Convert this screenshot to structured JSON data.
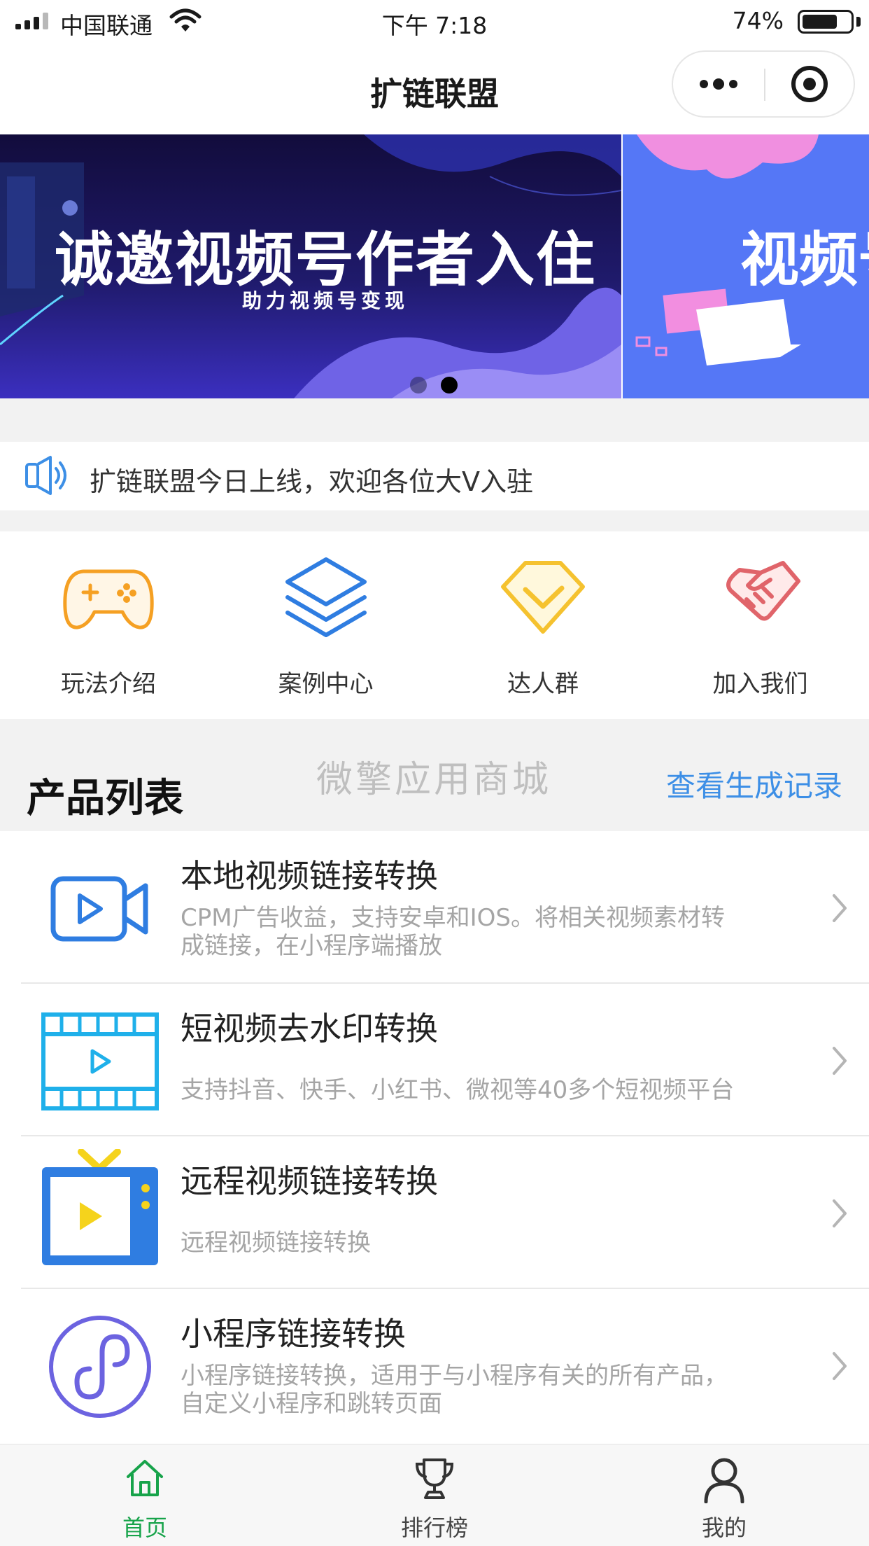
{
  "status_bar": {
    "carrier": "中国联通",
    "time": "下午 7:18",
    "battery_percent": "74%",
    "battery_level": 0.74,
    "icons": [
      "signal-icon",
      "wifi-icon",
      "battery-icon"
    ]
  },
  "nav": {
    "title": "扩链联盟",
    "icons": [
      "more-dots-icon",
      "close-capsule-icon"
    ]
  },
  "banner": {
    "slides": [
      {
        "title": "诚邀视频号作者入住",
        "subtitle": "助力视频号变现"
      },
      {
        "title": "视频号"
      }
    ],
    "active_index": 1
  },
  "notice": {
    "icon": "speaker-icon",
    "text": "扩链联盟今日上线，欢迎各位大V入驻"
  },
  "menu": [
    {
      "label": "玩法介绍",
      "icon": "gamepad-icon",
      "color": "#f5a023"
    },
    {
      "label": "案例中心",
      "icon": "layers-icon",
      "color": "#2f7de1"
    },
    {
      "label": "达人群",
      "icon": "diamond-check-icon",
      "color": "#f5c22f"
    },
    {
      "label": "加入我们",
      "icon": "handshake-icon",
      "color": "#e0646a"
    }
  ],
  "products_header": {
    "title": "产品列表",
    "watermark": "微擎应用商城",
    "link": "查看生成记录"
  },
  "products": [
    {
      "title": "本地视频链接转换",
      "desc_line1": "CPM广告收益，支持安卓和IOS。将相关视频素材转",
      "desc_line2": "成链接，在小程序端播放",
      "icon": "video-camera-icon"
    },
    {
      "title": "短视频去水印转换",
      "desc_line1": "支持抖音、快手、小红书、微视等40多个短视频平台",
      "desc_line2": "",
      "icon": "film-strip-icon"
    },
    {
      "title": "远程视频链接转换",
      "desc_line1": "远程视频链接转换",
      "desc_line2": "",
      "icon": "tv-icon"
    },
    {
      "title": "小程序链接转换",
      "desc_line1": "小程序链接转换，适用于与小程序有关的所有产品，",
      "desc_line2": "自定义小程序和跳转页面",
      "icon": "mini-program-icon"
    }
  ],
  "tabbar": [
    {
      "label": "首页",
      "icon": "home-icon",
      "active": true
    },
    {
      "label": "排行榜",
      "icon": "trophy-icon",
      "active": false
    },
    {
      "label": "我的",
      "icon": "user-icon",
      "active": false
    }
  ],
  "colors": {
    "accent_green": "#17a34a",
    "link_blue": "#3d8fe6",
    "banner_dark": "#1f1a6b",
    "banner_blue": "#5577f6"
  }
}
